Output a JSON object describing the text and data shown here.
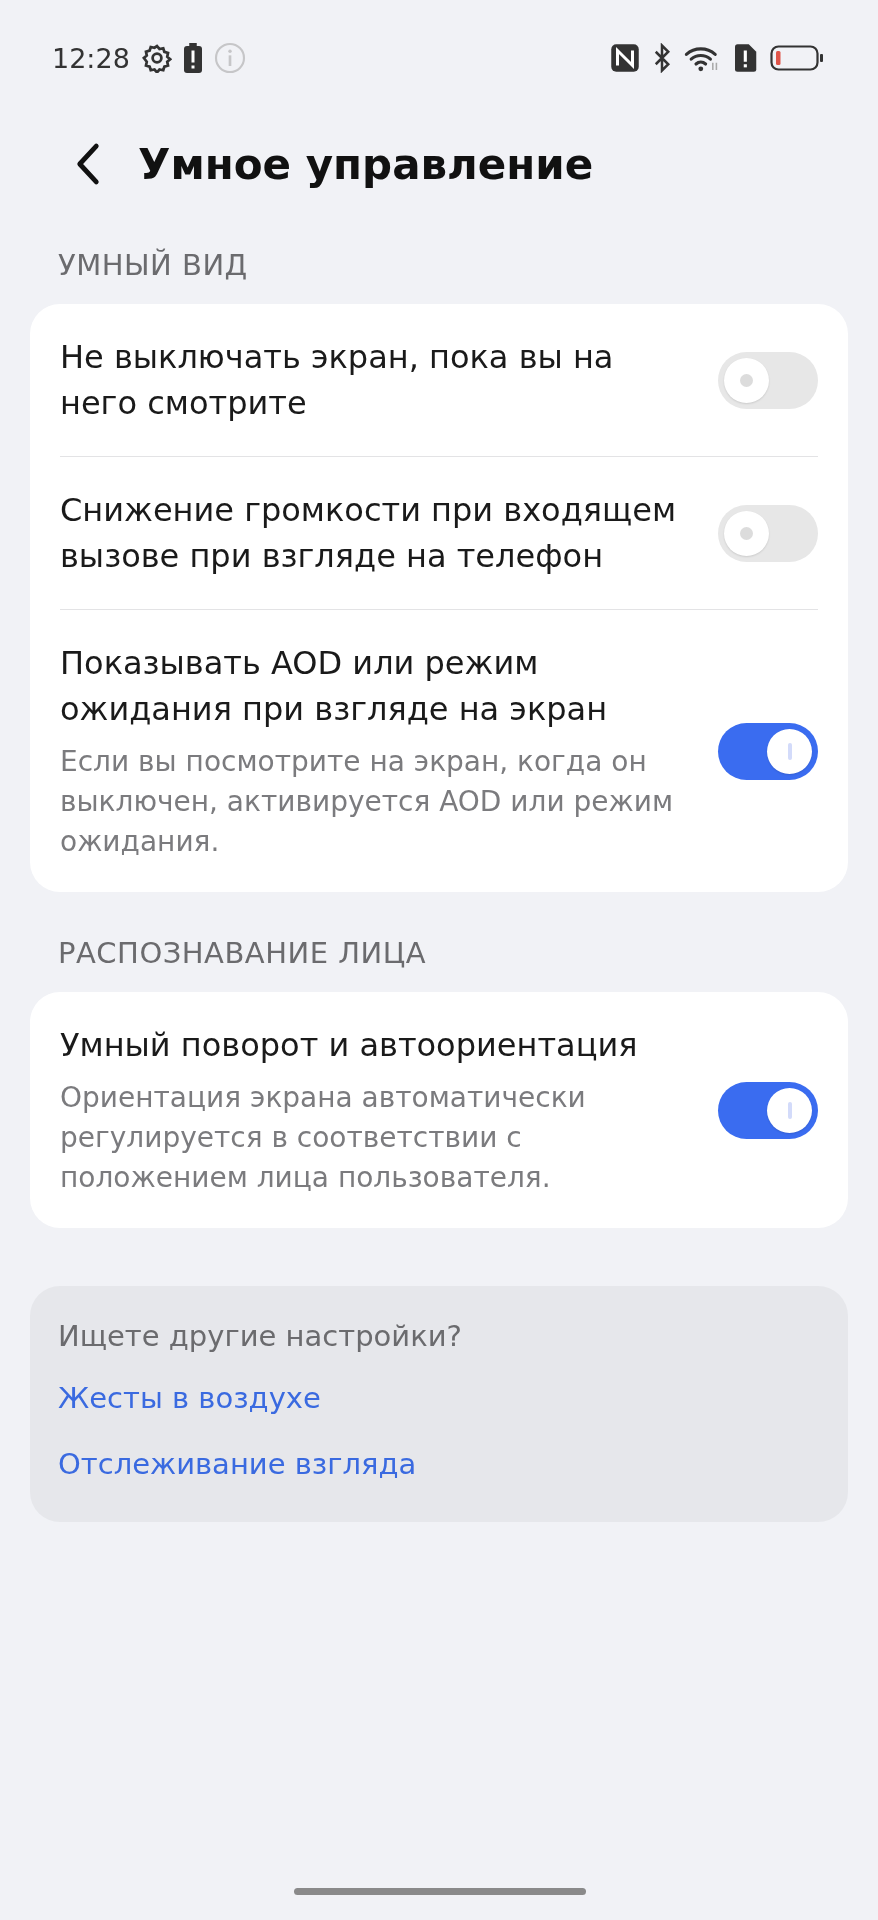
{
  "status_bar": {
    "time": "12:28"
  },
  "header": {
    "title": "Умное управление"
  },
  "sections": [
    {
      "title": "УМНЫЙ ВИД",
      "rows": [
        {
          "title": "Не выключать экран, пока вы на него смотрите",
          "on": false
        },
        {
          "title": "Снижение громкости при входящем вызове при взгляде на телефон",
          "on": false
        },
        {
          "title": "Показывать AOD или режим ожидания при взгляде на экран",
          "description": "Если вы посмотрите на экран, когда он выключен, активируется AOD или режим ожидания.",
          "on": true
        }
      ]
    },
    {
      "title": "РАСПОЗНАВАНИЕ ЛИЦА",
      "rows": [
        {
          "title": "Умный поворот и автоориентация",
          "description": "Ориентация экрана автоматически регулируется в соответствии с положением лица пользователя.",
          "on": true
        }
      ]
    }
  ],
  "more": {
    "prompt": "Ищете другие настройки?",
    "links": [
      "Жесты в воздухе",
      "Отслеживание взгляда"
    ]
  }
}
